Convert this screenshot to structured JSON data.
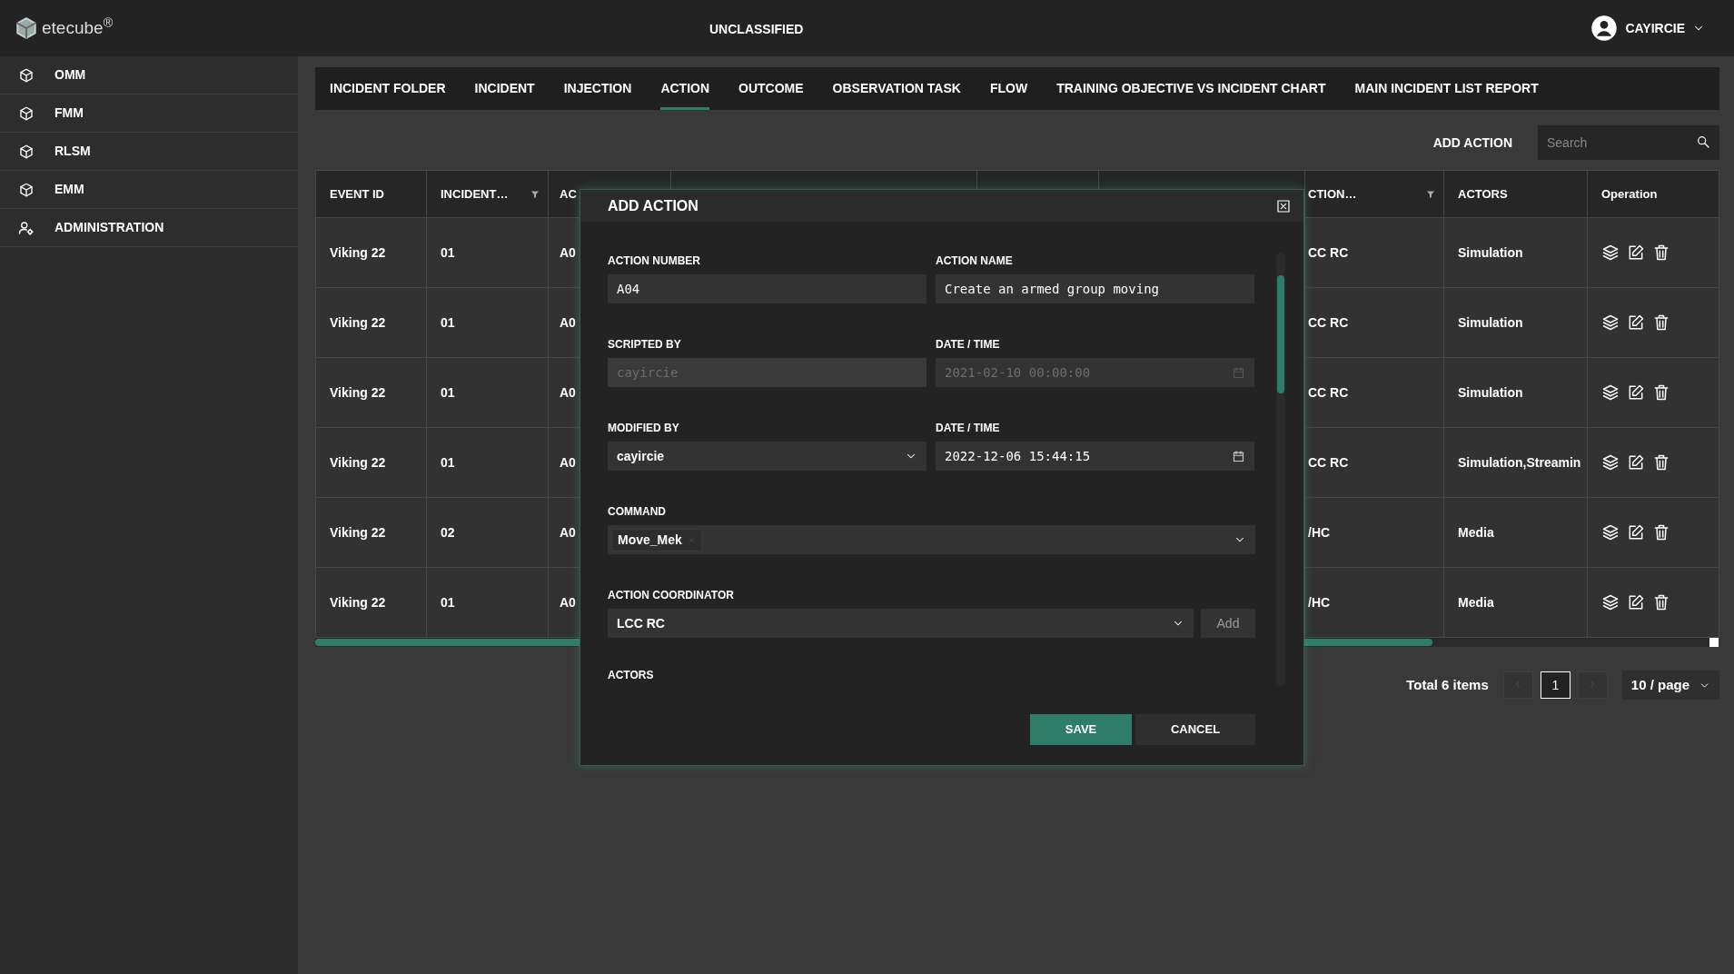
{
  "topbar": {
    "logo": "etecube$^{®}$",
    "classification": "UNCLASSIFIED",
    "user": "CAYIRCIE"
  },
  "sidebar": {
    "items": [
      {
        "label": "OMM",
        "kind": "module"
      },
      {
        "label": "FMM",
        "kind": "module"
      },
      {
        "label": "RLSM",
        "kind": "module"
      },
      {
        "label": "EMM",
        "kind": "module"
      },
      {
        "label": "ADMINISTRATION",
        "kind": "admin"
      }
    ]
  },
  "tabs": [
    {
      "label": "INCIDENT FOLDER",
      "selected": false
    },
    {
      "label": "INCIDENT",
      "selected": false
    },
    {
      "label": "INJECTION",
      "selected": false
    },
    {
      "label": "ACTION",
      "selected": true
    },
    {
      "label": "OUTCOME",
      "selected": false
    },
    {
      "label": "OBSERVATION TASK",
      "selected": false
    },
    {
      "label": "FLOW",
      "selected": false
    },
    {
      "label": "TRAINING OBJECTIVE VS INCIDENT CHART",
      "selected": false
    },
    {
      "label": "MAIN INCIDENT LIST REPORT",
      "selected": false
    }
  ],
  "toolbar": {
    "add_button": "ADD ACTION",
    "search": {
      "placeholder": "Search"
    }
  },
  "table": {
    "columns": [
      {
        "kind": "text",
        "label": "EVENT ID",
        "filter": false
      },
      {
        "kind": "text",
        "label": "INCIDENT…",
        "filter": true
      },
      {
        "kind": "text",
        "label": "AC"
      },
      {
        "kind": "covered"
      },
      {
        "kind": "covered"
      },
      {
        "kind": "covered"
      },
      {
        "kind": "text",
        "label": "CTION…",
        "filter": true
      },
      {
        "kind": "text",
        "label": "ACTORS",
        "filter": false
      },
      {
        "kind": "operation",
        "label": "Operation",
        "filter": false
      }
    ],
    "rows": [
      {
        "cells": [
          "Viking 22",
          "01",
          "A0",
          "CC RC",
          "Simulation"
        ]
      },
      {
        "cells": [
          "Viking 22",
          "01",
          "A0",
          "CC RC",
          "Simulation"
        ]
      },
      {
        "cells": [
          "Viking 22",
          "01",
          "A0",
          "CC RC",
          "Simulation"
        ]
      },
      {
        "cells": [
          "Viking 22",
          "01",
          "A0",
          "CC RC",
          "Simulation,Streamin"
        ]
      },
      {
        "cells": [
          "Viking 22",
          "02",
          "A0",
          "/HC",
          "Media"
        ]
      },
      {
        "cells": [
          "Viking 22",
          "01",
          "A0",
          "/HC",
          "Media"
        ]
      }
    ]
  },
  "pagination": {
    "total": "Total 6 items",
    "pages": [
      {
        "label": "1",
        "selected": true
      }
    ],
    "page_size": "10 / page"
  },
  "modal": {
    "title": "ADD ACTION",
    "fields": [
      {
        "label": "ACTION NUMBER",
        "kind": "text",
        "value": "A04",
        "disabled": false
      },
      {
        "label": "ACTION NAME",
        "kind": "text",
        "value": "Create an armed group moving",
        "disabled": false
      },
      {
        "label": "SCRIPTED BY",
        "kind": "text",
        "value": "cayircie",
        "disabled": true
      },
      {
        "label": "DATE / TIME",
        "kind": "date",
        "value": "2021-02-10 00:00:00",
        "disabled": true
      },
      {
        "label": "MODIFIED BY",
        "kind": "select",
        "value": "cayircie",
        "disabled": false
      },
      {
        "label": "DATE / TIME",
        "kind": "date",
        "value": "2022-12-06 15:44:15",
        "disabled": false
      },
      {
        "label": "COMMAND",
        "kind": "tags",
        "tags": [
          "Move_Mek"
        ],
        "disabled": false
      },
      {
        "label": "ACTION COORDINATOR",
        "kind": "select_add",
        "value": "LCC RC",
        "add_label": "Add",
        "disabled": false
      }
    ],
    "section_label": "ACTORS",
    "buttons": [
      {
        "label": "SAVE",
        "kind": "primary"
      },
      {
        "label": "CANCEL",
        "kind": "secondary"
      }
    ]
  }
}
